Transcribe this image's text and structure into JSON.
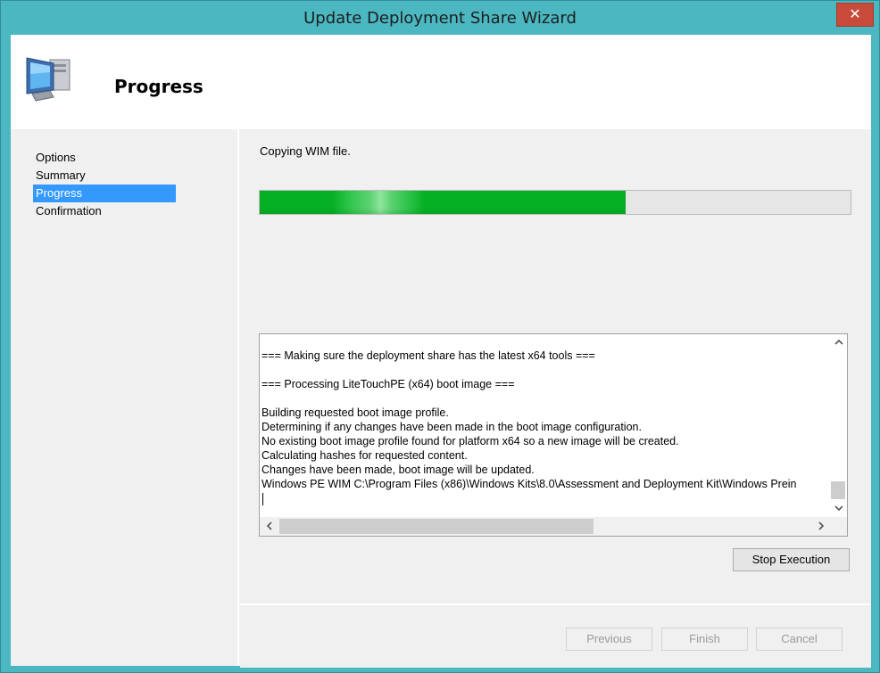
{
  "window": {
    "title": "Update Deployment Share Wizard",
    "close_glyph": "✕"
  },
  "header": {
    "title": "Progress",
    "icon": "computer-icon"
  },
  "sidebar": {
    "items": [
      {
        "label": "Options",
        "active": false
      },
      {
        "label": "Summary",
        "active": false
      },
      {
        "label": "Progress",
        "active": true
      },
      {
        "label": "Confirmation",
        "active": false
      }
    ]
  },
  "main": {
    "status": "Copying WIM file.",
    "progress_fraction": 0.62,
    "log_lines": [
      "=== Making sure the deployment share has the latest x64 tools ===",
      "",
      "=== Processing LiteTouchPE (x64) boot image ===",
      "",
      "Building requested boot image profile.",
      "Determining if any changes have been made in the boot image configuration.",
      "No existing boot image profile found for platform x64 so a new image will be created.",
      "Calculating hashes for requested content.",
      "Changes have been made, boot image will be updated.",
      "Windows PE WIM C:\\Program Files (x86)\\Windows Kits\\8.0\\Assessment and Deployment Kit\\Windows Prein"
    ],
    "stop_button": "Stop Execution",
    "scroll_up": "^",
    "scroll_down": "v",
    "scroll_left": "<",
    "scroll_right": ">"
  },
  "footer": {
    "previous": "Previous",
    "finish": "Finish",
    "cancel": "Cancel"
  },
  "colors": {
    "accent": "#3399ff",
    "progress": "#06b025",
    "frame": "#4bb7c1",
    "close": "#c74a3a"
  }
}
